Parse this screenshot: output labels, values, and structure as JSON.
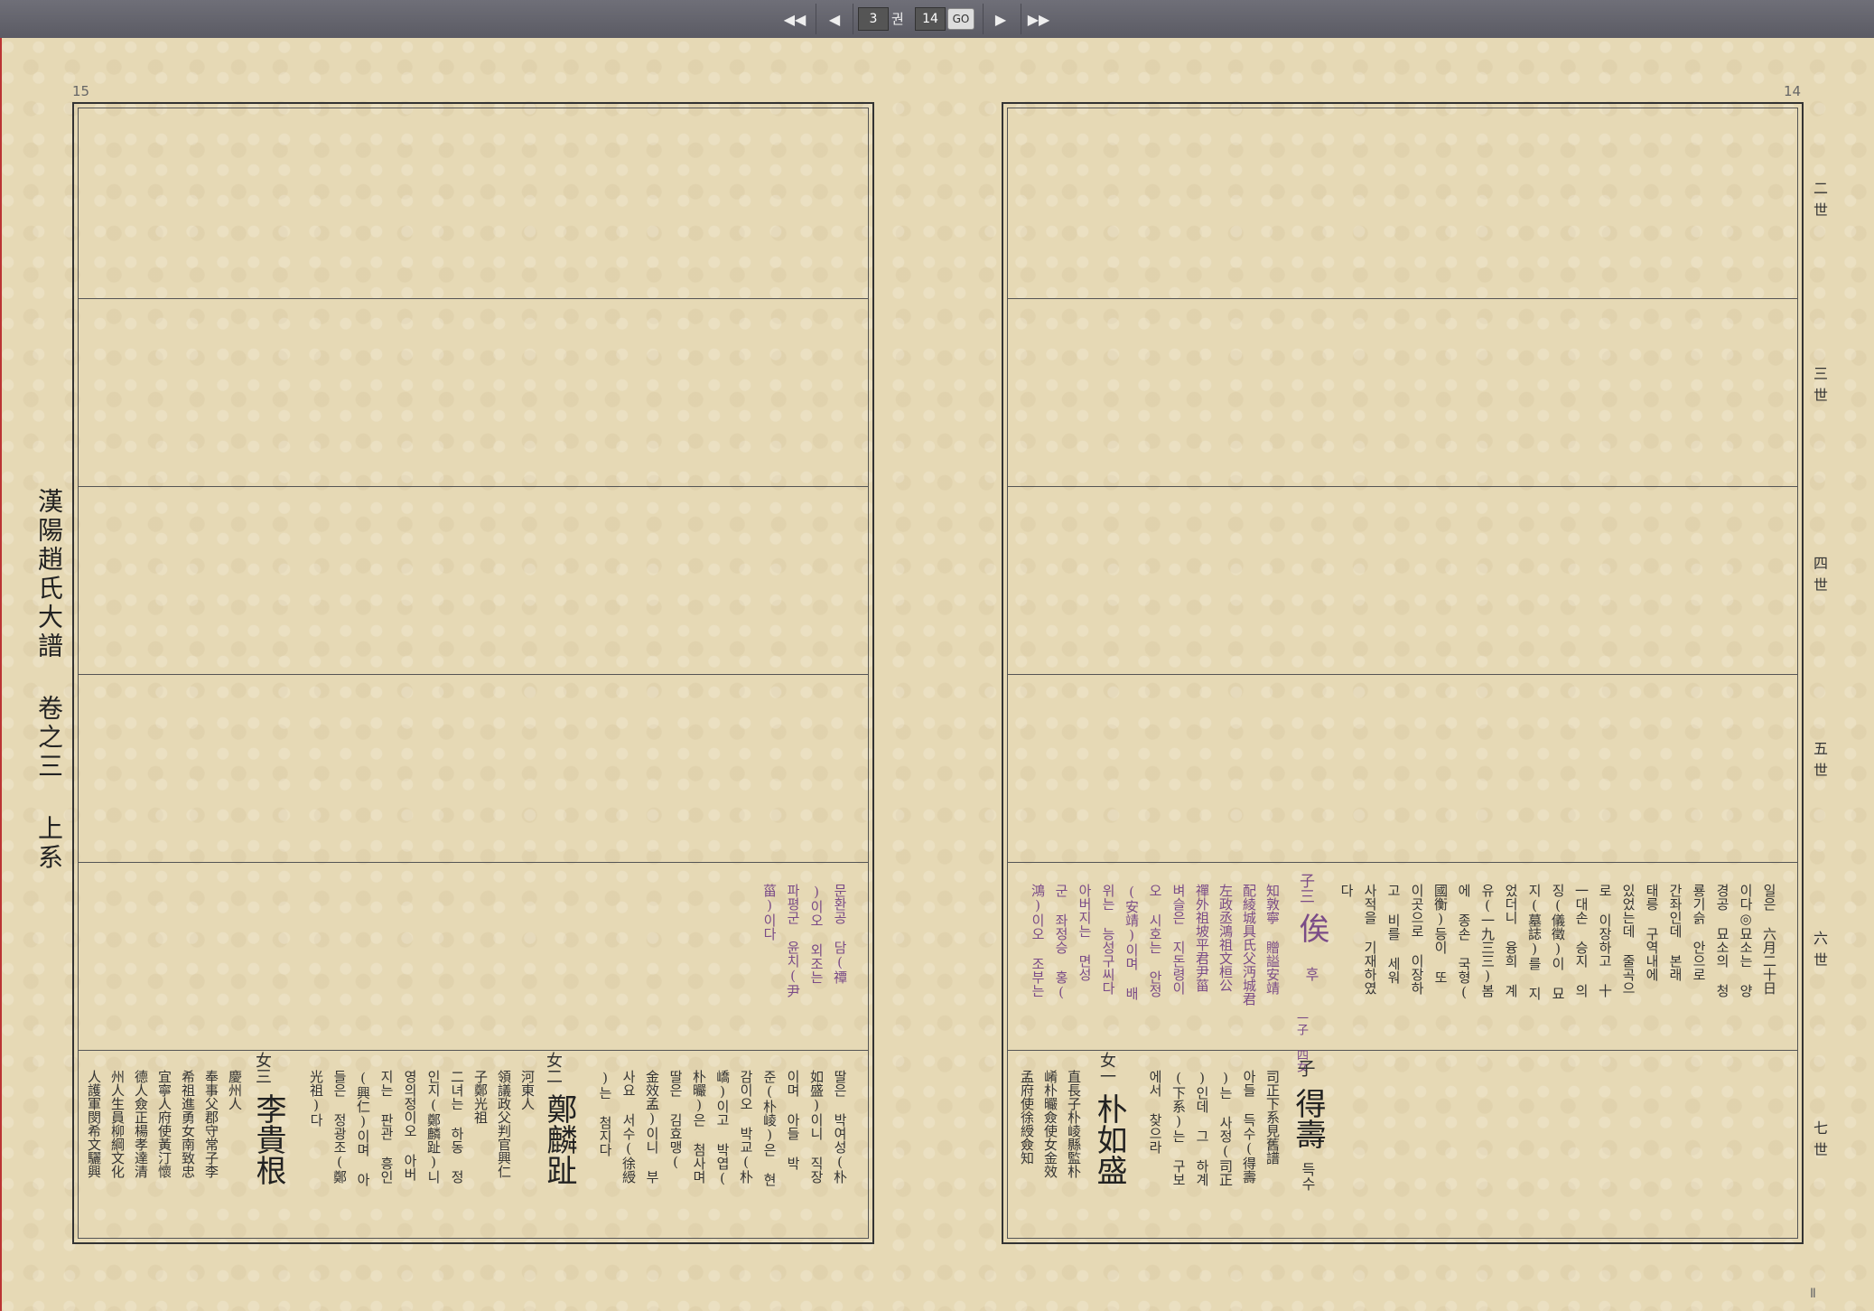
{
  "toolbar": {
    "first": "◀◀",
    "prev": "◀",
    "volume": "3",
    "volume_unit": "권",
    "page": "14",
    "go": "GO",
    "next": "▶",
    "last": "▶▶"
  },
  "pages": {
    "left_num": "15",
    "right_num": "14",
    "bottom_right_mark": "Ⅱ"
  },
  "book_title": "漢陽趙氏大譜 卷之三 上系",
  "generations": [
    "二世",
    "三世",
    "四世",
    "五世",
    "六世",
    "七世"
  ],
  "right_page": {
    "notes_row6": [
      "일은 六月二十日",
      "이다◎묘소는 양",
      "경공 묘소의 청",
      "룡기슭 안으로",
      "간좌인데 본래",
      "태릉 구역내에",
      "있었는데 줄곡으",
      "로 이장하고 十",
      "一대손 승지 의",
      "징(儀徵)이 묘",
      "지(墓誌)를 지",
      "었더니 융희 계",
      "유(一九三三)봄",
      "에 종손 국형(",
      "國衡)등이 또",
      "이곳으로 이장하",
      "고 비를 세워",
      "사적을 기재하였",
      "다"
    ],
    "person6": {
      "title": "子三",
      "name": "俟",
      "reading": "후",
      "children": "一子 四女",
      "details_purple": [
        "知敦寧 贈謚安靖",
        "配綾城具氏父沔城君",
        "左政丞鴻祖文桓公",
        "禪外祖坡平君尹菑",
        "벼슬은 지돈령이",
        "오 시호는 안정",
        "(安靖)이며 배",
        "위는 능성구씨다",
        "아버지는 면성",
        "군 좌정승 홍(",
        "鴻)이오 조부는"
      ]
    },
    "person7a": {
      "title": "子",
      "name": "得壽",
      "reading": "득수",
      "details": [
        "司正下系見舊譜",
        "아들 득수(得壽",
        ")는 사정(司正",
        ")인데 그 하계",
        "(下系)는 구보",
        "에서 찾으라"
      ]
    },
    "person7b": {
      "title": "女一",
      "name": "朴如盛",
      "details": [
        "直長子朴崚縣監朴",
        "崤朴曮僉使女金效",
        "孟府使徐綬僉知"
      ]
    }
  },
  "left_page": {
    "notes_row6_purple": [
      "문환공 담(禫",
      ")이오 외조는",
      "파평군 윤치(尹",
      "菑)이다"
    ],
    "row7_cols": [
      "딸은 박여성(朴",
      "如盛)이니 직장",
      "이며 아들 박",
      "준(朴崚)은 현",
      "감이오 박교(朴",
      "嶠)이고 박엽(",
      "朴曮)은 첨사며",
      "딸은 김효맹(",
      "金效孟)이니 부",
      "사요 서수(徐綬",
      ")는 첨지다"
    ],
    "person_b": {
      "title": "女二",
      "name": "鄭麟趾",
      "details": [
        "河東人",
        "領議政父判官興仁",
        "子鄭光祖",
        "二녀는 하동 정",
        "인지(鄭麟趾)니",
        "영의정이오 아버",
        "지는 판관 흥인",
        "(興仁)이며 아",
        "들은 정광조(鄭",
        "光祖)다"
      ]
    },
    "person_c": {
      "title": "女三",
      "name": "李貴根",
      "details": [
        "慶州人",
        "奉事父郡守常子李",
        "希祖進勇女南致忠",
        "宜寧人府使黃汀懷",
        "德人僉正楊孝達清",
        "州人生員柳綱文化",
        "人護軍閔希文驪興"
      ]
    }
  }
}
